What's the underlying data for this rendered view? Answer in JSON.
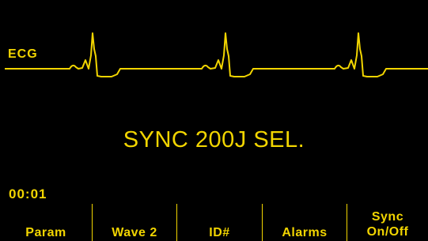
{
  "waveform": {
    "lead_label": "ECG",
    "trace_color": "#f2d500"
  },
  "status": {
    "message": "SYNC 200J SEL."
  },
  "timer": {
    "elapsed": "00:01"
  },
  "softkeys": [
    {
      "label_line1": "",
      "label_line2": "Param"
    },
    {
      "label_line1": "",
      "label_line2": "Wave 2"
    },
    {
      "label_line1": "",
      "label_line2": "ID#"
    },
    {
      "label_line1": "",
      "label_line2": "Alarms"
    },
    {
      "label_line1": "Sync",
      "label_line2": "On/Off"
    }
  ],
  "colors": {
    "background": "#000000",
    "foreground": "#f2d500"
  }
}
